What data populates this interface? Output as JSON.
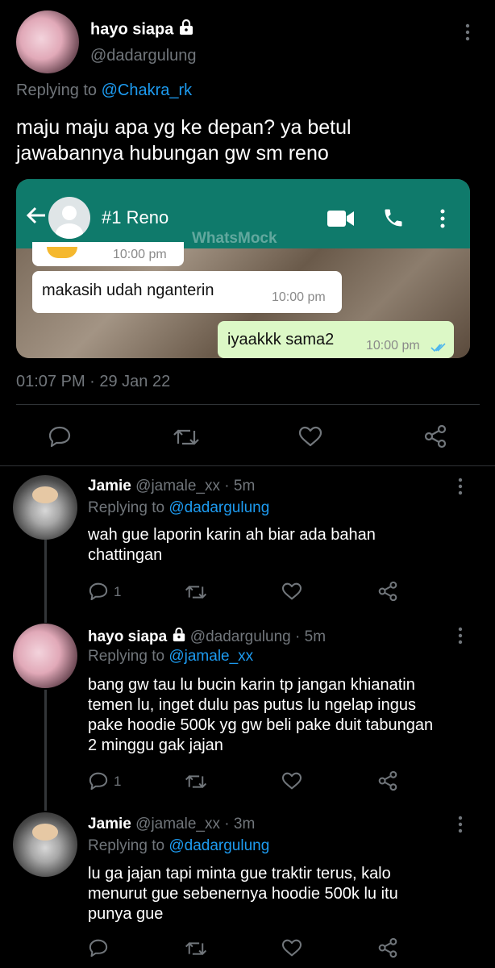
{
  "main_tweet": {
    "display_name": "hayo siapa",
    "handle": "@dadargulung",
    "replying_prefix": "Replying to",
    "replying_to": "@Chakra_rk",
    "text_line1": "maju maju apa yg ke depan? ya betul",
    "text_line2": "jawabannya hubungan gw sm reno",
    "timestamp": "01:07 PM · 29 Jan 22"
  },
  "wa": {
    "contact": "#1 Reno",
    "watermark": "WhatsMock",
    "top_time": "10:00 pm",
    "msg1": "makasih udah nganterin",
    "msg1_time": "10:00 pm",
    "msg2": "iyaakkk sama2",
    "msg2_time": "10:00 pm"
  },
  "replies": [
    {
      "name": "Jamie",
      "handle": "@jamale_xx",
      "age": "· 5m",
      "replying_prefix": "Replying to",
      "replying_to": "@dadargulung",
      "lines": [
        "wah gue laporin karin ah biar ada bahan",
        "chattingan"
      ],
      "reply_count": "1"
    },
    {
      "name": "hayo siapa",
      "handle": "@dadargulung",
      "age": "· 5m",
      "replying_prefix": "Replying to",
      "replying_to": "@jamale_xx",
      "lines": [
        "bang gw tau lu bucin karin tp jangan khianatin",
        "temen lu, inget dulu pas putus lu ngelap ingus",
        "pake hoodie 500k yg gw beli pake duit tabungan",
        "2 minggu gak jajan"
      ],
      "reply_count": "1"
    },
    {
      "name": "Jamie",
      "handle": "@jamale_xx",
      "age": "· 3m",
      "replying_prefix": "Replying to",
      "replying_to": "@dadargulung",
      "lines": [
        "lu ga jajan tapi minta gue traktir terus, kalo",
        "menurut gue sebenernya hoodie 500k lu itu",
        "punya gue"
      ],
      "reply_count": ""
    }
  ]
}
